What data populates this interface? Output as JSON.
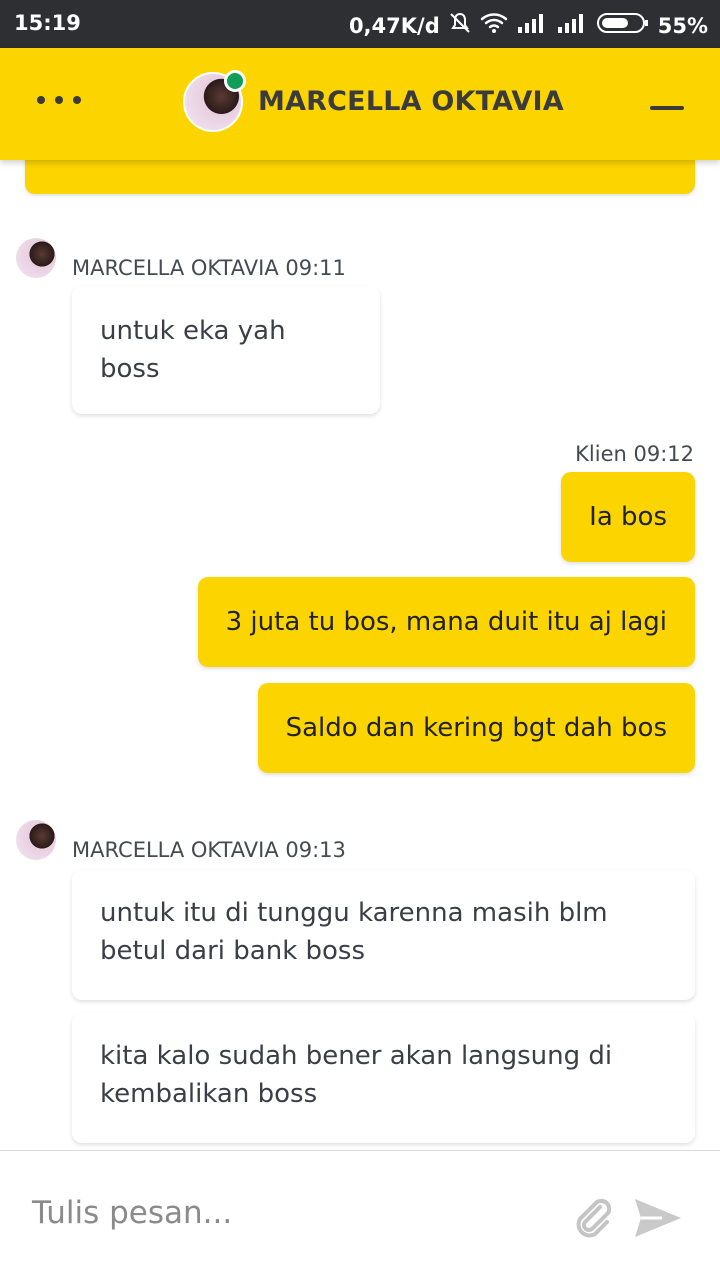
{
  "status_bar": {
    "time": "15:19",
    "network_speed": "0,47K/d",
    "battery_percent": "55%",
    "icons": [
      "mute-bell-icon",
      "wifi-icon",
      "signal-icon",
      "signal-icon",
      "battery-icon"
    ]
  },
  "header": {
    "title": "MARCELLA OKTAVIA",
    "menu_icon": "more-dots-icon",
    "minimize_icon": "minimize-icon",
    "online": true
  },
  "messages": [
    {
      "sender": "agent",
      "meta": "MARCELLA OKTAVIA 09:11",
      "bubbles": [
        "untuk eka yah boss"
      ]
    },
    {
      "sender": "client",
      "meta": "Klien 09:12",
      "bubbles": [
        "Ia bos",
        "3 juta tu bos, mana duit itu aj lagi",
        "Saldo dan kering bgt dah bos"
      ]
    },
    {
      "sender": "agent",
      "meta": "MARCELLA OKTAVIA 09:13",
      "bubbles": [
        "untuk itu di tunggu karenna masih blm betul dari bank boss",
        "kita kalo sudah bener akan langsung di kembalikan boss"
      ]
    }
  ],
  "composer": {
    "placeholder": "Tulis pesan...",
    "attach_icon": "paperclip-icon",
    "send_icon": "send-icon"
  },
  "colors": {
    "accent": "#fcd500",
    "status_bar": "#2d2f33",
    "online": "#0f9d58"
  }
}
